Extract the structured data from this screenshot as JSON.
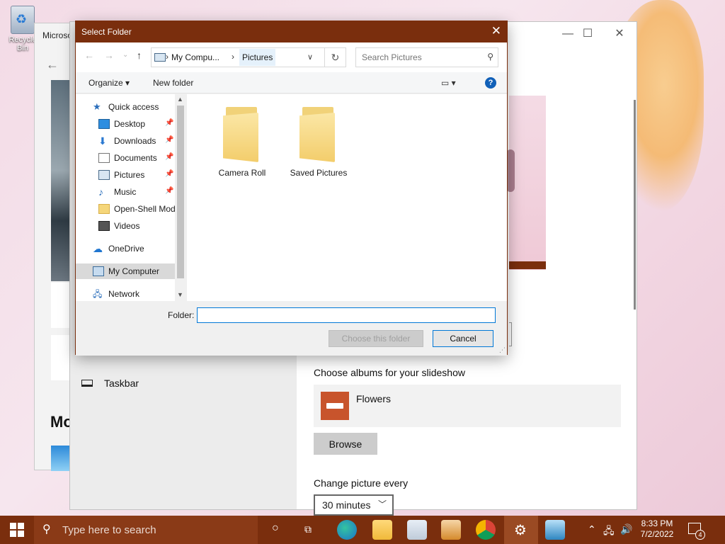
{
  "desktop": {
    "recycle_label": "Recycle Bin"
  },
  "back_window": {
    "title": "Microsoft Store",
    "heading": "Mo"
  },
  "settings": {
    "sidebar_taskbar": "Taskbar",
    "choose_albums": "Choose albums for your slideshow",
    "album_name": "Flowers",
    "browse": "Browse",
    "change_picture": "Change picture every",
    "interval": "30 minutes"
  },
  "dialog": {
    "title": "Select Folder",
    "address": {
      "crumb1": "My Compu...",
      "crumb2": "Pictures"
    },
    "search_placeholder": "Search Pictures",
    "toolbar": {
      "organize": "Organize",
      "new_folder": "New folder"
    },
    "nav": [
      {
        "label": "Quick access",
        "icon": "star-icon",
        "pinned": false
      },
      {
        "label": "Desktop",
        "icon": "desktop-icon",
        "pinned": true
      },
      {
        "label": "Downloads",
        "icon": "download-icon",
        "pinned": true
      },
      {
        "label": "Documents",
        "icon": "document-icon",
        "pinned": true
      },
      {
        "label": "Pictures",
        "icon": "pictures-icon",
        "pinned": true
      },
      {
        "label": "Music",
        "icon": "music-icon",
        "pinned": true
      },
      {
        "label": "Open-Shell Mod",
        "icon": "folder-icon",
        "pinned": false
      },
      {
        "label": "Videos",
        "icon": "video-icon",
        "pinned": false
      },
      {
        "label": "OneDrive",
        "icon": "cloud-icon",
        "pinned": false
      },
      {
        "label": "My Computer",
        "icon": "computer-icon",
        "pinned": false
      },
      {
        "label": "Network",
        "icon": "network-icon",
        "pinned": false
      }
    ],
    "folders": [
      "Camera Roll",
      "Saved Pictures"
    ],
    "folder_label": "Folder:",
    "folder_value": "",
    "choose_button": "Choose this folder",
    "cancel_button": "Cancel"
  },
  "taskbar": {
    "search_placeholder": "Type here to search",
    "time": "8:33 PM",
    "date": "7/2/2022",
    "notification_count": "4"
  },
  "colors": {
    "accent": "#7a2e0d",
    "dialog_bg": "#f0f0f0",
    "selection": "#d9d9d9"
  }
}
